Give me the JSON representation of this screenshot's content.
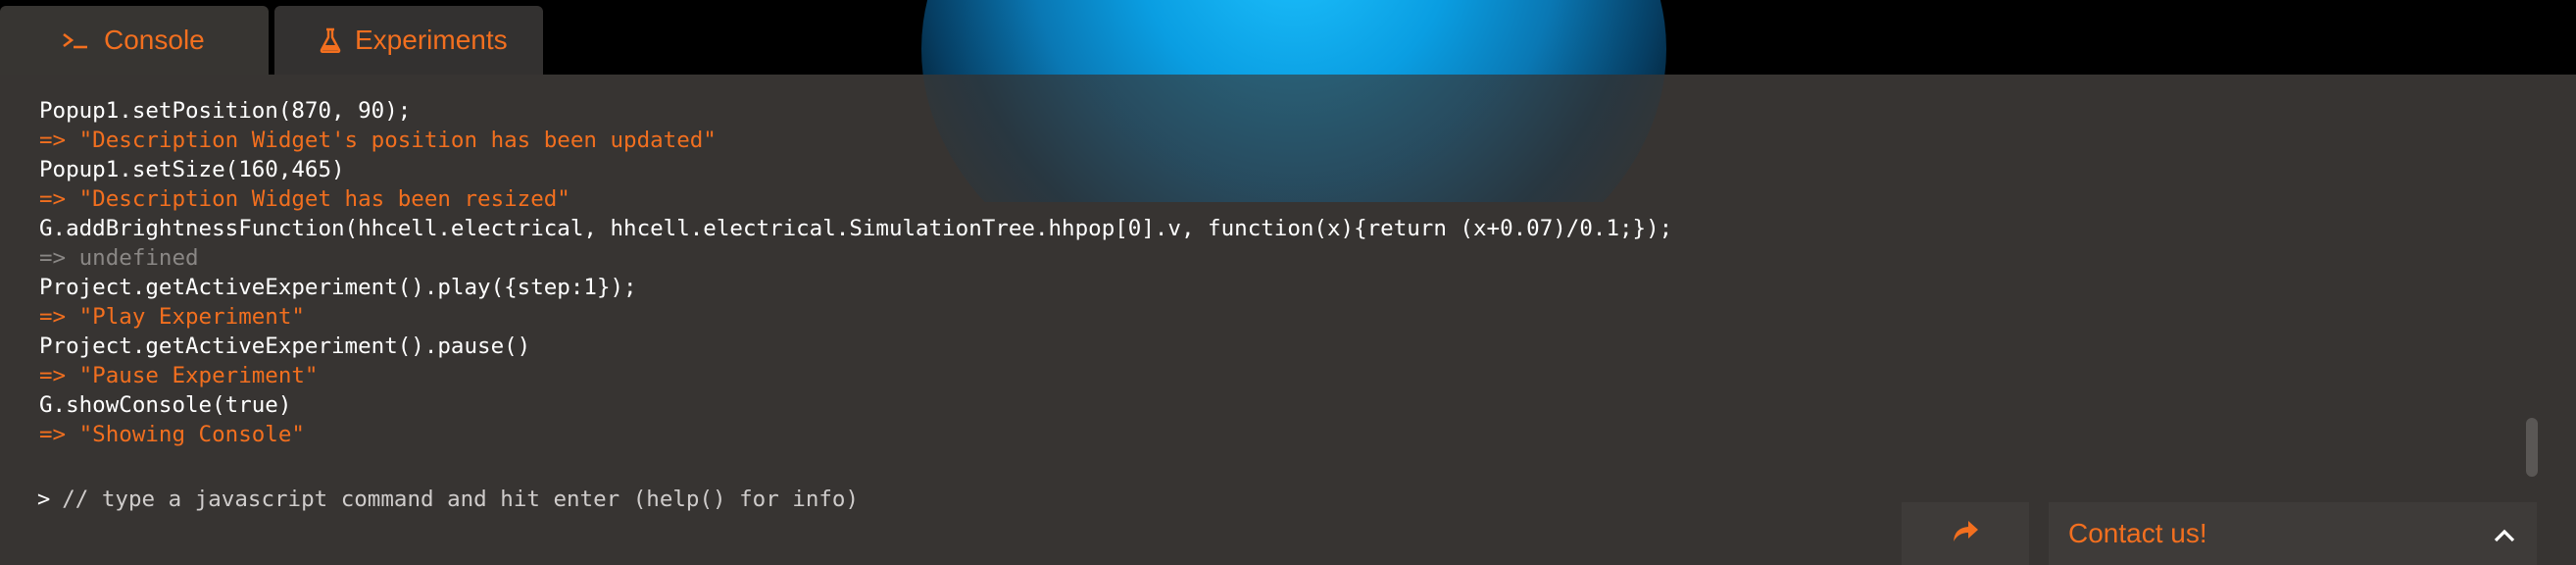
{
  "tabs": [
    {
      "label": "Console",
      "icon": "terminal-icon"
    },
    {
      "label": "Experiments",
      "icon": "flask-icon"
    }
  ],
  "console": {
    "lines": [
      {
        "type": "cmd",
        "text": "Popup1.setPosition(870, 90);"
      },
      {
        "type": "res",
        "text": "=> \"Description Widget's position has been updated\""
      },
      {
        "type": "cmd",
        "text": "Popup1.setSize(160,465)"
      },
      {
        "type": "res",
        "text": "=> \"Description Widget has been resized\""
      },
      {
        "type": "cmd",
        "text": "G.addBrightnessFunction(hhcell.electrical, hhcell.electrical.SimulationTree.hhpop[0].v, function(x){return (x+0.07)/0.1;});"
      },
      {
        "type": "muted",
        "text": "=> undefined"
      },
      {
        "type": "cmd",
        "text": "Project.getActiveExperiment().play({step:1});"
      },
      {
        "type": "res",
        "text": "=> \"Play Experiment\""
      },
      {
        "type": "cmd",
        "text": "Project.getActiveExperiment().pause()"
      },
      {
        "type": "res",
        "text": "=> \"Pause Experiment\""
      },
      {
        "type": "cmd",
        "text": "G.showConsole(true)"
      },
      {
        "type": "res",
        "text": "=> \"Showing Console\""
      }
    ],
    "prompt_symbol": ">",
    "input_placeholder": "// type a javascript command and hit enter (help() for info)"
  },
  "footer": {
    "contact_label": "Contact us!",
    "share_icon": "share-arrow-icon",
    "chevron_icon": "chevron-up-icon"
  },
  "colors": {
    "accent": "#f26f1f",
    "panel_bg": "#373432",
    "muted_text": "#8a8785"
  }
}
